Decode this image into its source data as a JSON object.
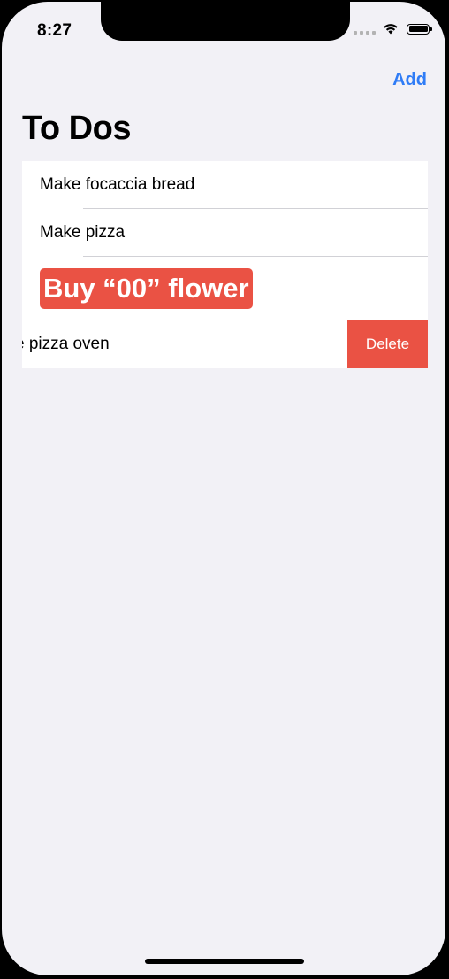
{
  "status_bar": {
    "time": "8:27"
  },
  "nav": {
    "add_label": "Add"
  },
  "page": {
    "title": "To Dos"
  },
  "todos": [
    {
      "label": "Make focaccia bread"
    },
    {
      "label": "Make pizza"
    },
    {
      "label": "Buy “00” flower"
    },
    {
      "label": "e pizza oven"
    }
  ],
  "swipe_action": {
    "delete_label": "Delete"
  },
  "colors": {
    "accent": "#2f7cf6",
    "destructive": "#ea5244",
    "background": "#f2f1f6"
  }
}
